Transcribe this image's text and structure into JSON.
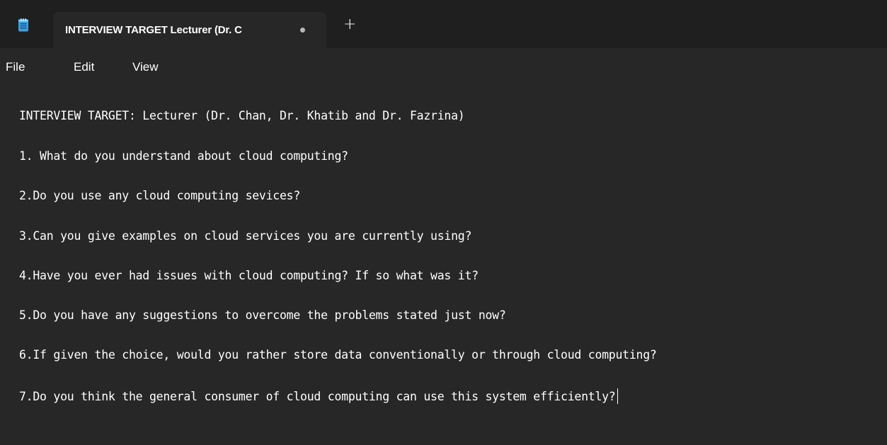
{
  "tab": {
    "title": "INTERVIEW TARGET Lecturer (Dr. C",
    "unsaved_indicator": "dot",
    "new_tab_symbol": "+"
  },
  "icons": {
    "app": "notepad-icon",
    "unsaved": "unsaved-dot-icon",
    "new_tab": "plus-icon"
  },
  "menu": {
    "file": "File",
    "edit": "Edit",
    "view": "View"
  },
  "document": {
    "lines": [
      "INTERVIEW TARGET: Lecturer (Dr. Chan, Dr. Khatib and Dr. Fazrina)",
      "1. What do you understand about cloud computing?",
      "2.Do you use any cloud computing sevices?",
      "3.Can you give examples on cloud services you are currently using?",
      "4.Have you ever had issues with cloud computing? If so what was it?",
      "5.Do you have any suggestions to overcome the problems stated just now?",
      "6.If given the choice, would you rather store data conventionally or through cloud computing?",
      "7.Do you think the general consumer of cloud computing can use this system efficiently?"
    ]
  },
  "colors": {
    "background": "#272727",
    "tabstrip": "#1f1f1f",
    "text": "#ffffff",
    "accent_icon": "#4cc2ff"
  }
}
